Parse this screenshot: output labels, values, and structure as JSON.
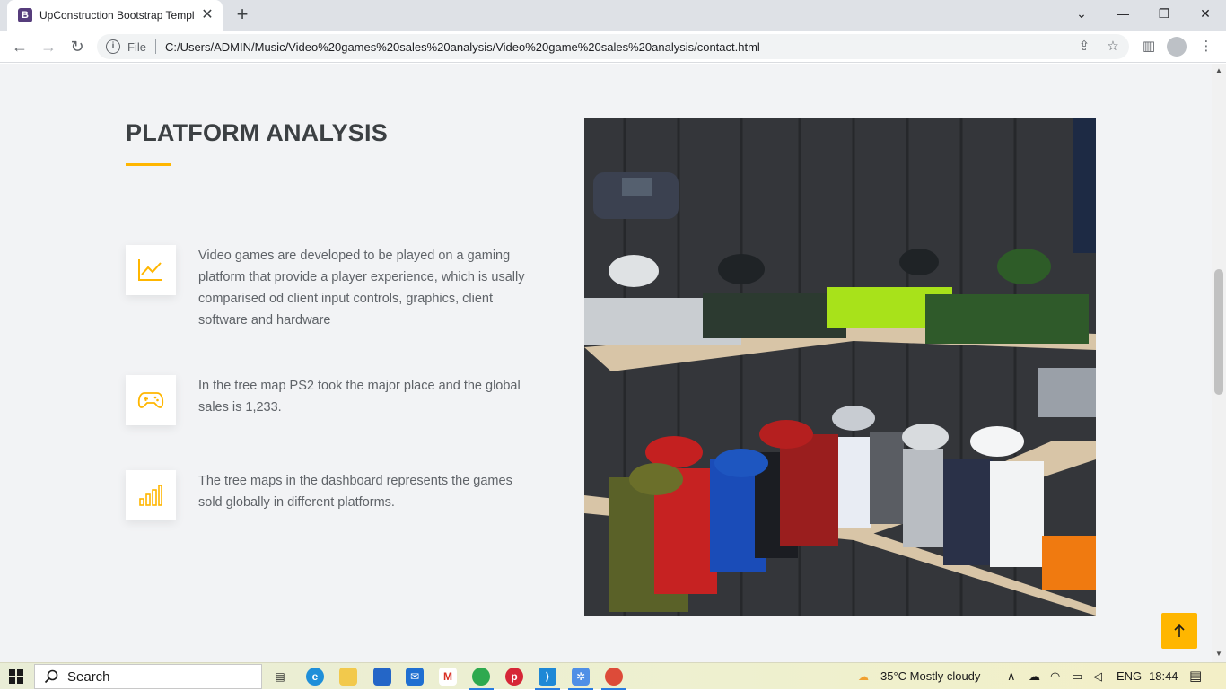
{
  "browser": {
    "tab_title": "UpConstruction Bootstrap Templ",
    "tab_favicon_letter": "B",
    "address_prefix": "File",
    "url": "C:/Users/ADMIN/Music/Video%20games%20sales%20analysis/Video%20game%20sales%20analysis/contact.html",
    "icons": [
      "back-icon",
      "forward-icon",
      "reload-icon",
      "info-icon",
      "share-icon",
      "star-icon",
      "side-panel-icon",
      "profile-icon",
      "chevron-down-icon",
      "minimize-icon",
      "restore-icon",
      "close-icon",
      "new-tab-icon"
    ]
  },
  "section": {
    "title": "PLATFORM ANALYSIS",
    "accent_color": "#ffb600",
    "features": [
      {
        "icon": "line-chart-icon",
        "text": "Video games are developed to be played on a gaming platform that provide a player experience, which is usally comparised od client input controls, graphics, client software and hardware"
      },
      {
        "icon": "gamepad-icon",
        "text": "In the tree map PS2 took the major place and the global sales is 1,233."
      },
      {
        "icon": "bar-chart-icon",
        "text": "The tree maps in the dashboard represents the games sold globally in different platforms."
      }
    ],
    "image_subject": "consoles-on-shelves-photo"
  },
  "back_to_top": {
    "icon": "arrow-up-icon"
  },
  "taskbar": {
    "search_label": "Search",
    "weather": "35°C  Mostly cloudy",
    "language": "ENG",
    "time": "18:44",
    "apps": [
      "task-view-icon",
      "edge-icon",
      "file-explorer-icon",
      "store-icon",
      "mail-icon",
      "gmail-icon",
      "chrome-icon",
      "pinterest-icon",
      "vscode-icon",
      "snipping-icon",
      "chrome-active-icon"
    ]
  }
}
